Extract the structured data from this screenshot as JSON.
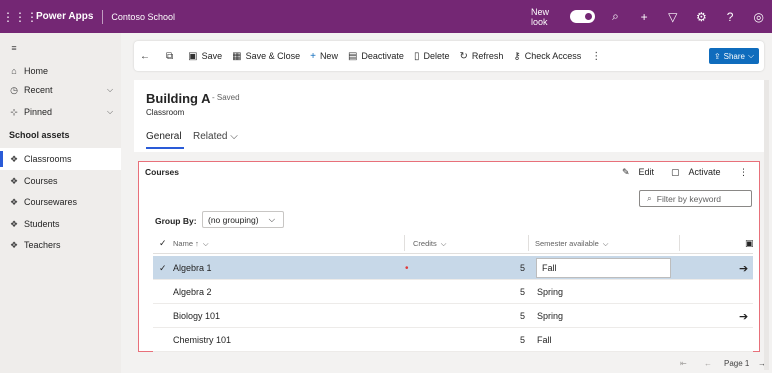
{
  "topbar": {
    "app_name": "Power Apps",
    "environment": "Contoso School",
    "new_look_label": "New look"
  },
  "sidebar": {
    "nav": [
      {
        "label": "Home"
      },
      {
        "label": "Recent"
      },
      {
        "label": "Pinned"
      }
    ],
    "section_title": "School assets",
    "items": [
      {
        "label": "Classrooms"
      },
      {
        "label": "Courses"
      },
      {
        "label": "Coursewares"
      },
      {
        "label": "Students"
      },
      {
        "label": "Teachers"
      }
    ]
  },
  "commandbar": {
    "save": "Save",
    "save_close": "Save & Close",
    "new": "New",
    "deactivate": "Deactivate",
    "delete": "Delete",
    "refresh": "Refresh",
    "check_access": "Check Access",
    "share": "Share"
  },
  "record": {
    "title": "Building A",
    "status": "- Saved",
    "entity": "Classroom",
    "tabs": {
      "general": "General",
      "related": "Related"
    }
  },
  "subgrid": {
    "title": "Courses",
    "edit": "Edit",
    "activate": "Activate",
    "filter_placeholder": "Filter by keyword",
    "group_by_label": "Group By:",
    "group_by_value": "(no grouping)",
    "columns": {
      "name": "Name ↑",
      "credits": "Credits",
      "semester": "Semester available"
    },
    "rows": [
      {
        "name": "Algebra 1",
        "credits": "5",
        "semester": "Fall"
      },
      {
        "name": "Algebra 2",
        "credits": "5",
        "semester": "Spring"
      },
      {
        "name": "Biology 101",
        "credits": "5",
        "semester": "Spring"
      },
      {
        "name": "Chemistry 101",
        "credits": "5",
        "semester": "Fall"
      }
    ],
    "page_label": "Page 1"
  },
  "colors": {
    "topbar": "#742774",
    "accent": "#2a5bd7",
    "share_button": "#0f6cbd",
    "selected_row": "#c7d8e8",
    "panel_border": "#e8707a",
    "required_marker": "#e03a3a"
  }
}
